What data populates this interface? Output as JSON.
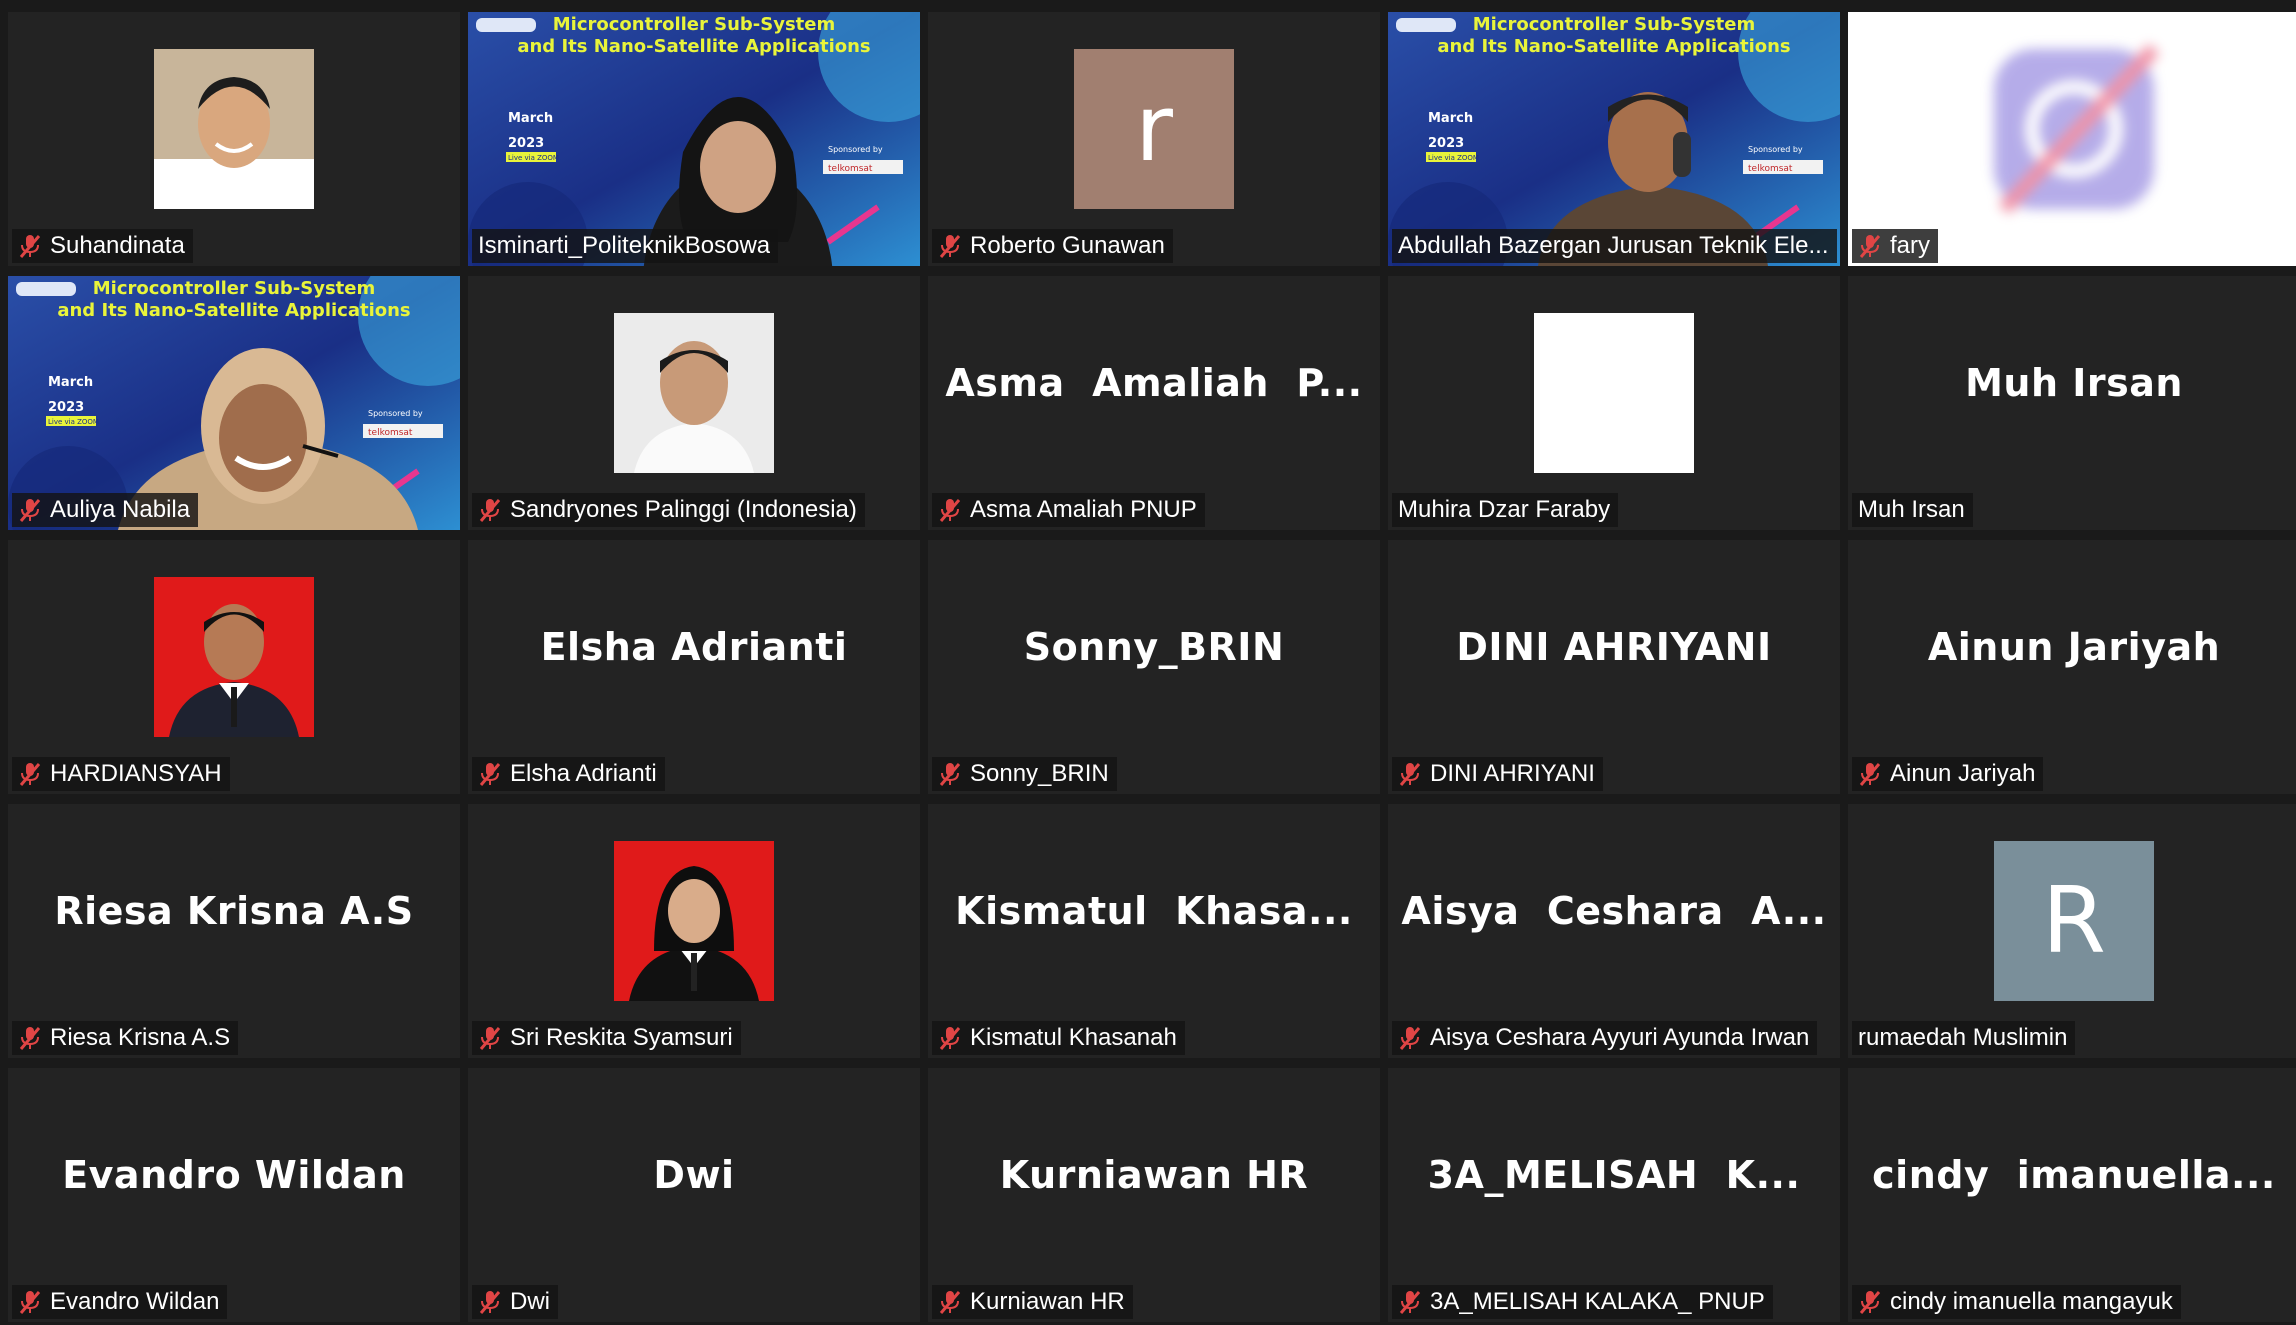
{
  "colors": {
    "tile_bg": "#232323",
    "page_bg": "#1a1a1a",
    "active_border": "#d8e34a",
    "mute_icon": "#e04545"
  },
  "participants": [
    {
      "label": "Suhandinata",
      "muted": true,
      "display": "photo"
    },
    {
      "label": "Isminarti_PoliteknikBosowa",
      "muted": false,
      "display": "video"
    },
    {
      "label": "Roberto Gunawan",
      "muted": true,
      "display": "letter",
      "avatar_letter": "r",
      "avatar_color": "#a17f70"
    },
    {
      "label": "Abdullah Bazergan Jurusan Teknik Ele...",
      "muted": false,
      "display": "video",
      "active_speaker": true
    },
    {
      "label": "fary",
      "muted": true,
      "display": "blurred-logo"
    },
    {
      "label": "Auliya Nabila",
      "muted": true,
      "display": "video"
    },
    {
      "label": "Sandryones Palinggi (Indonesia)",
      "muted": true,
      "display": "photo"
    },
    {
      "label": "Asma Amaliah PNUP",
      "muted": true,
      "display": "name",
      "center_name": "Asma  Amaliah  P..."
    },
    {
      "label": "Muhira Dzar Faraby",
      "muted": false,
      "display": "blank-photo"
    },
    {
      "label": "Muh Irsan",
      "muted": false,
      "display": "name",
      "center_name": "Muh Irsan"
    },
    {
      "label": "HARDIANSYAH",
      "muted": true,
      "display": "photo"
    },
    {
      "label": "Elsha Adrianti",
      "muted": true,
      "display": "name",
      "center_name": "Elsha Adrianti"
    },
    {
      "label": "Sonny_BRIN",
      "muted": true,
      "display": "name",
      "center_name": "Sonny_BRIN"
    },
    {
      "label": "DINI AHRIYANI",
      "muted": true,
      "display": "name",
      "center_name": "DINI AHRIYANI"
    },
    {
      "label": "Ainun Jariyah",
      "muted": true,
      "display": "name",
      "center_name": "Ainun Jariyah"
    },
    {
      "label": "Riesa Krisna A.S",
      "muted": true,
      "display": "name",
      "center_name": "Riesa Krisna A.S"
    },
    {
      "label": "Sri Reskita Syamsuri",
      "muted": true,
      "display": "photo"
    },
    {
      "label": "Kismatul Khasanah",
      "muted": true,
      "display": "name",
      "center_name": "Kismatul  Khasa..."
    },
    {
      "label": "Aisya Ceshara Ayyuri Ayunda Irwan",
      "muted": true,
      "display": "name",
      "center_name": "Aisya  Ceshara  A..."
    },
    {
      "label": "rumaedah Muslimin",
      "muted": false,
      "display": "letter",
      "avatar_letter": "R",
      "avatar_color": "#7a8f9a"
    },
    {
      "label": "Evandro Wildan",
      "muted": true,
      "display": "name",
      "center_name": "Evandro Wildan"
    },
    {
      "label": "Dwi",
      "muted": true,
      "display": "name",
      "center_name": "Dwi"
    },
    {
      "label": "Kurniawan HR",
      "muted": true,
      "display": "name",
      "center_name": "Kurniawan HR"
    },
    {
      "label": "3A_MELISAH KALAKA_ PNUP",
      "muted": true,
      "display": "name",
      "center_name": "3A_MELISAH  K..."
    },
    {
      "label": "cindy imanuella mangayuk",
      "muted": true,
      "display": "name",
      "center_name": "cindy  imanuella..."
    }
  ],
  "banner": {
    "title_line1": "Microcontroller Sub-System",
    "title_line2": "and Its Nano-Satellite Applications",
    "month": "March",
    "year": "2023",
    "live": "Live via ZOOM",
    "sponsored": "Sponsored by",
    "sponsor": "telkomsat"
  }
}
